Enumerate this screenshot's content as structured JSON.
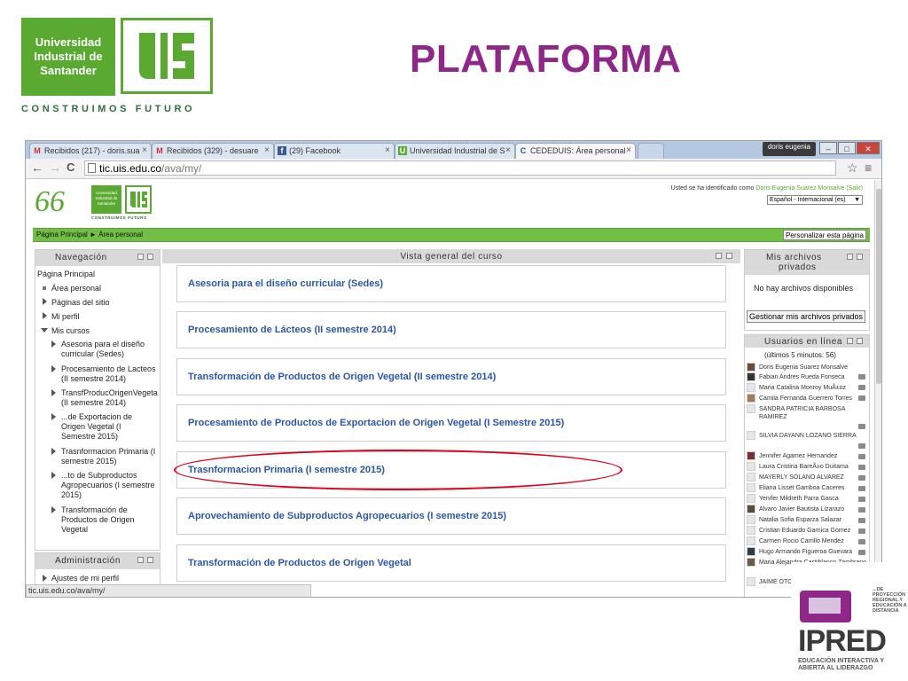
{
  "slide": {
    "title": "PLATAFORMA",
    "uis_logo": {
      "line1": "Universidad",
      "line2": "Industrial de",
      "line3": "Santander",
      "tagline": "CONSTRUIMOS FUTURO"
    },
    "ipred_logo": {
      "word": "IPRED",
      "small": "...DE PROYECCIÓN REGIONAL Y EDUCACIÓN A DISTANCIA",
      "tag": "EDUCACIÓN INTERACTIVA Y ABIERTA AL LIDERAZGO"
    }
  },
  "browser": {
    "tabs": [
      {
        "icon": "M",
        "label": "Recibidos (217) - doris.sua",
        "close": "×"
      },
      {
        "icon": "M",
        "label": "Recibidos (329) - desuare",
        "close": "×"
      },
      {
        "icon": "f",
        "label": "(29) Facebook",
        "close": "×"
      },
      {
        "icon": "U",
        "label": "Universidad Industrial de S",
        "close": "×"
      },
      {
        "icon": "C",
        "label": "CEDEDUIS: Área personal",
        "close": "×"
      }
    ],
    "user_chip": "doris eugenia",
    "window_buttons": {
      "minimize": "–",
      "maximize": "□",
      "close": "✕"
    },
    "nav": {
      "back": "←",
      "forward": "→",
      "reload": "C"
    },
    "url_host": "tic.uis.edu.co",
    "url_path": "/ava/my/",
    "star": "☆",
    "menu": "≡",
    "status_url": "tic.uis.edu.co/ava/my/"
  },
  "moodle": {
    "logo_66": "66",
    "logo": {
      "text": "Universidad Industrial de Santander",
      "tag": "CONSTRUIMOS FUTURO"
    },
    "login_prefix": "Usted se ha identificado como ",
    "login_name": "Doris Eugenia Suarez Monsalve",
    "login_logout": " (Salir)",
    "language": "Español - Internacional (es)",
    "language_arrow": "▼",
    "breadcrumb": "Página Principal ► Área personal",
    "customise": "Personalizar esta página",
    "navigation": {
      "title": "Navegación",
      "items": [
        {
          "label": "Página Principal"
        },
        {
          "label": "Área personal"
        },
        {
          "label": "Páginas del sitio"
        },
        {
          "label": "Mi perfil"
        },
        {
          "label": "Mis cursos"
        },
        {
          "label": "Asesoria para el diseño curricular (Sedes)"
        },
        {
          "label": "Procesamiento de Lacteos (II semestre 2014)"
        },
        {
          "label": "TransfProducOrigenVegeta (II semestre 2014)"
        },
        {
          "label": "...de Exportacion de Origen Vegetal (I Semestre 2015)"
        },
        {
          "label": "Trasnformacion Primaria (I semestre 2015)"
        },
        {
          "label": "...to de Subproductos Agropecuarios (I semestre 2015)"
        },
        {
          "label": "Transformación de Productos de Origen Vegetal"
        }
      ]
    },
    "administration": {
      "title": "Administración",
      "items": [
        {
          "label": "Ajustes de mi perfil"
        }
      ]
    },
    "course_overview": {
      "title": "Vista general del curso",
      "courses": [
        "Asesoria para el diseño curricular (Sedes)",
        "Procesamiento de Lácteos (II semestre 2014)",
        "Transformación de Productos de Origen Vegetal (II semestre 2014)",
        "Procesamiento de Productos de Exportacion de Origen Vegetal (I Semestre 2015)",
        "Trasnformacion Primaria (I semestre 2015)",
        "Aprovechamiento de Subproductos Agropecuarios (I semestre 2015)",
        "Transformación de Productos de Origen Vegetal"
      ]
    },
    "private_files": {
      "title_line1": "Mis archivos",
      "title_line2": "privados",
      "empty": "No hay archivos disponibles",
      "manage": "Gestionar mis archivos privados"
    },
    "online_users": {
      "title": "Usuarios en línea",
      "subtitle": "(últimos 5 minutos: 56)",
      "users": [
        "Doris Eugenia Suarez Monsalve",
        "Fabian Andres Rueda Fonseca",
        "Maria Catalina Monroy MuÃ±oz",
        "Camila Fernanda Guerrero Torres",
        "SANDRA PATRICIA BARBOSA RAMIREZ",
        "SILVIA DAYANN LOZANO SIERRA",
        "Jennifer Agamez Hernandez",
        "Laura Cristina BareÃ±o Duitama",
        "MAYERLY SOLANO ALVAREZ",
        "Eliana Lisset Gamboa Caceres",
        "Yenifer Mildreth Parra Gasca",
        "Alvaro Javier Bautista Lizarazo",
        "Natalia Sofia Esparza Salazar",
        "Cristian Eduardo Garnica Gomez",
        "Carmen Rocio Carrillo Mendez",
        "Hugo Armando Figueroa Guevara",
        "Maria Alejandra Castiblanco Zambrano",
        "JAIME OTONIEL AYALA PIMENTEL"
      ]
    }
  }
}
